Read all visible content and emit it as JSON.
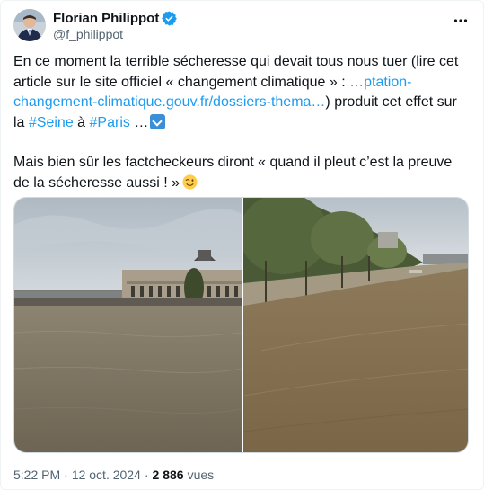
{
  "author": {
    "display_name": "Florian Philippot",
    "handle": "@f_philippot"
  },
  "tweet": {
    "paragraph1": {
      "text_a": "En ce moment la terrible sécheresse qui devait tous nous tuer (lire cet article sur le site officiel « changement climatique » : ",
      "link_text": "…ptation-changement-climatique.gouv.fr/dossiers-thema…",
      "text_b": ") produit cet effet sur la ",
      "hashtag1": "#Seine",
      "text_c": " à ",
      "hashtag2": "#Paris",
      "text_d": " …"
    },
    "paragraph2": "Mais bien sûr les factcheckeurs diront « quand il pleut c’est la preuve de la sécheresse aussi ! »",
    "emojis": [
      "arrow-curving-down",
      "winking-face"
    ]
  },
  "media": {
    "images": [
      {
        "subject": "flooded-seine-musee-orsay"
      },
      {
        "subject": "flooded-seine-quay-trees"
      }
    ]
  },
  "meta": {
    "time": "5:22 PM",
    "separator": "·",
    "date": "12 oct. 2024",
    "views_count": "2 886",
    "views_label": "vues"
  },
  "colors": {
    "text": "#0f1419",
    "secondary": "#536471",
    "link": "#1d9bf0",
    "verified": "#1d9bf0",
    "border": "#cfd9de"
  }
}
